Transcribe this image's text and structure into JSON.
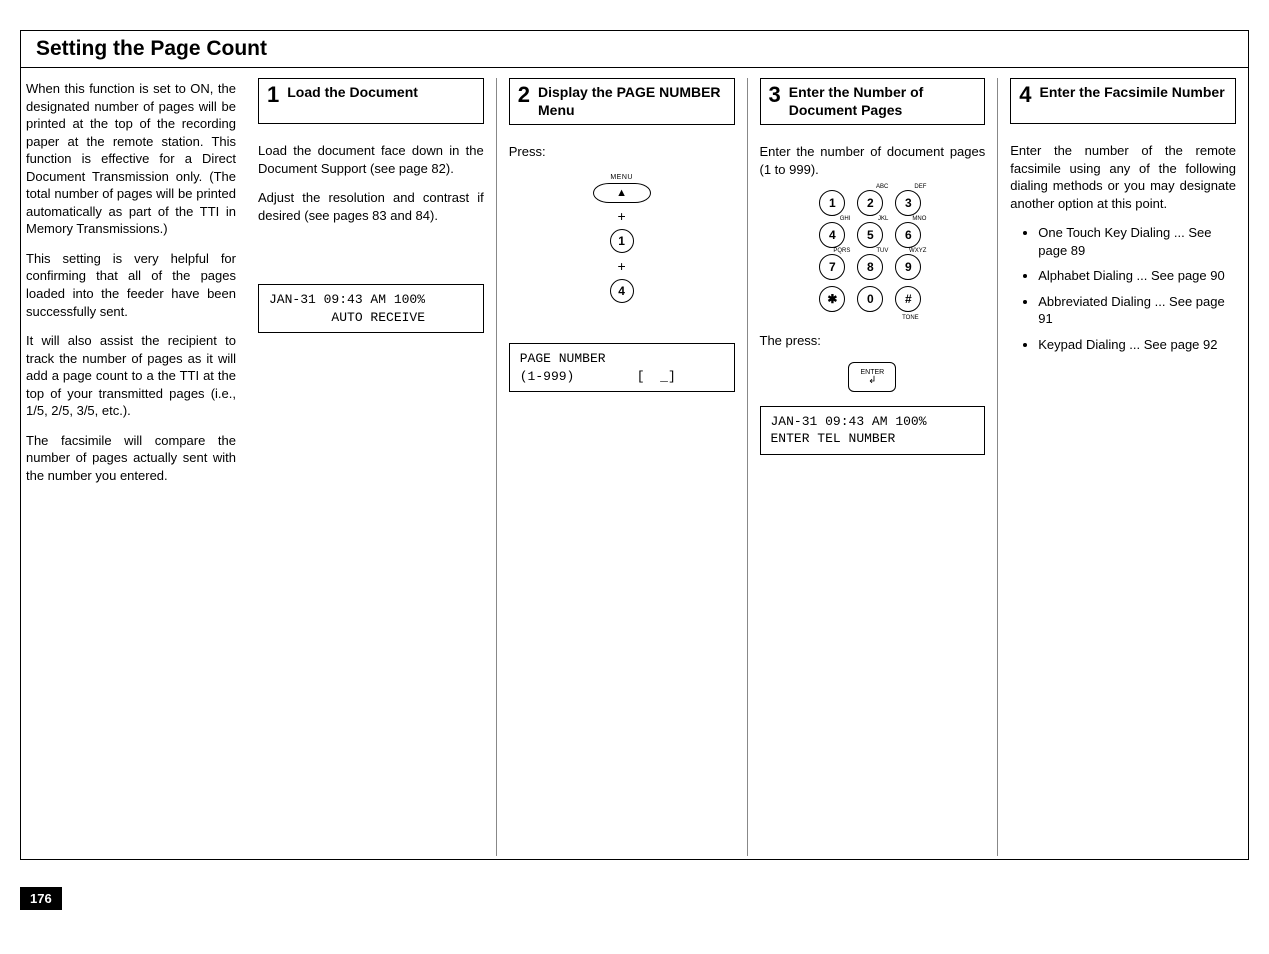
{
  "page_number": "176",
  "section_title": "Setting the Page Count",
  "intro": {
    "p1": "When this function is set to ON, the designated number of pages will be printed at the top of the recording paper at the remote station. This function is effective for a Direct Document Transmission only. (The total number of pages will be printed automatically as part of the TTI in Memory Transmissions.)",
    "p2": "This setting is very helpful for confirming that all of the pages loaded into the feeder have been successfully sent.",
    "p3": "It will also assist the recipient to track the number of pages as it will add a page count to a the TTI at the top of your transmitted pages (i.e., 1/5, 2/5, 3/5, etc.).",
    "p4": "The facsimile will compare the number of pages actually sent with the number you entered."
  },
  "steps": [
    {
      "num": "1",
      "title": "Load the Document",
      "body1": "Load the document face down in the Document Support (see page 82).",
      "body2": "Adjust the resolution and contrast if desired (see pages 83 and 84).",
      "lcd": "JAN-31 09:43 AM 100%\n        AUTO RECEIVE"
    },
    {
      "num": "2",
      "title": "Display the PAGE NUMBER Menu",
      "body1": "Press:",
      "menu_label": "MENU",
      "key1": "1",
      "key2": "4",
      "lcd": "PAGE NUMBER\n(1-999)        [  _]"
    },
    {
      "num": "3",
      "title": "Enter the Number of Document Pages",
      "body1": "Enter the number of document pages (1 to 999).",
      "keypad": [
        "1",
        "2",
        "3",
        "4",
        "5",
        "6",
        "7",
        "8",
        "9",
        "✱",
        "0",
        "#"
      ],
      "sups": [
        "",
        "ABC",
        "DEF",
        "GHI",
        "JKL",
        "MNO",
        "PQRS",
        "TUV",
        "WXYZ",
        "",
        "",
        ""
      ],
      "tone": "TONE",
      "body2": "The press:",
      "enter_label": "ENTER",
      "lcd": "JAN-31 09:43 AM 100%\nENTER TEL NUMBER"
    },
    {
      "num": "4",
      "title": "Enter the Facsimile Number",
      "body1": "Enter the number of the remote facsimile using any of the following dialing methods or you may designate another option at this point.",
      "list": [
        "One Touch Key Dialing ... See page 89",
        "Alphabet Dialing ... See page 90",
        "Abbreviated Dialing ... See page 91",
        "Keypad Dialing ... See page 92"
      ]
    }
  ]
}
